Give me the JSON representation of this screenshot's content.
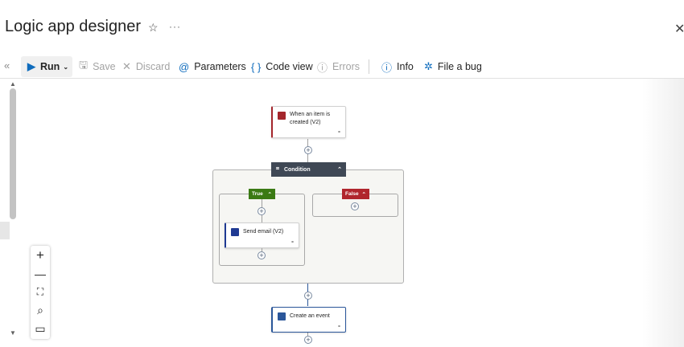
{
  "header": {
    "title": "Logic app designer",
    "favorite_icon": "star-icon",
    "more_label": "···",
    "close_icon": "close-icon"
  },
  "toolbar": {
    "collapse_label": "«",
    "run_label": "Run",
    "save_label": "Save",
    "discard_label": "Discard",
    "parameters_label": "Parameters",
    "code_view_label": "Code view",
    "errors_label": "Errors",
    "info_label": "Info",
    "file_bug_label": "File a bug"
  },
  "canvas": {
    "trigger": {
      "label": "When an item is created (V2)",
      "color": "#a4262c"
    },
    "condition": {
      "label": "Condition",
      "color": "#3f4855"
    },
    "true_branch": {
      "label": "True",
      "color": "#3b7a14"
    },
    "false_branch": {
      "label": "False",
      "color": "#b0262d"
    },
    "send_email": {
      "label": "Send email (V2)",
      "color": "#1f3a93"
    },
    "create_event": {
      "label": "Create an event",
      "color": "#2b579a"
    }
  },
  "zoom_controls": {
    "zoom_in": "+",
    "zoom_out": "—",
    "fit": "⛶",
    "search": "⌕",
    "minimap": "▭"
  }
}
